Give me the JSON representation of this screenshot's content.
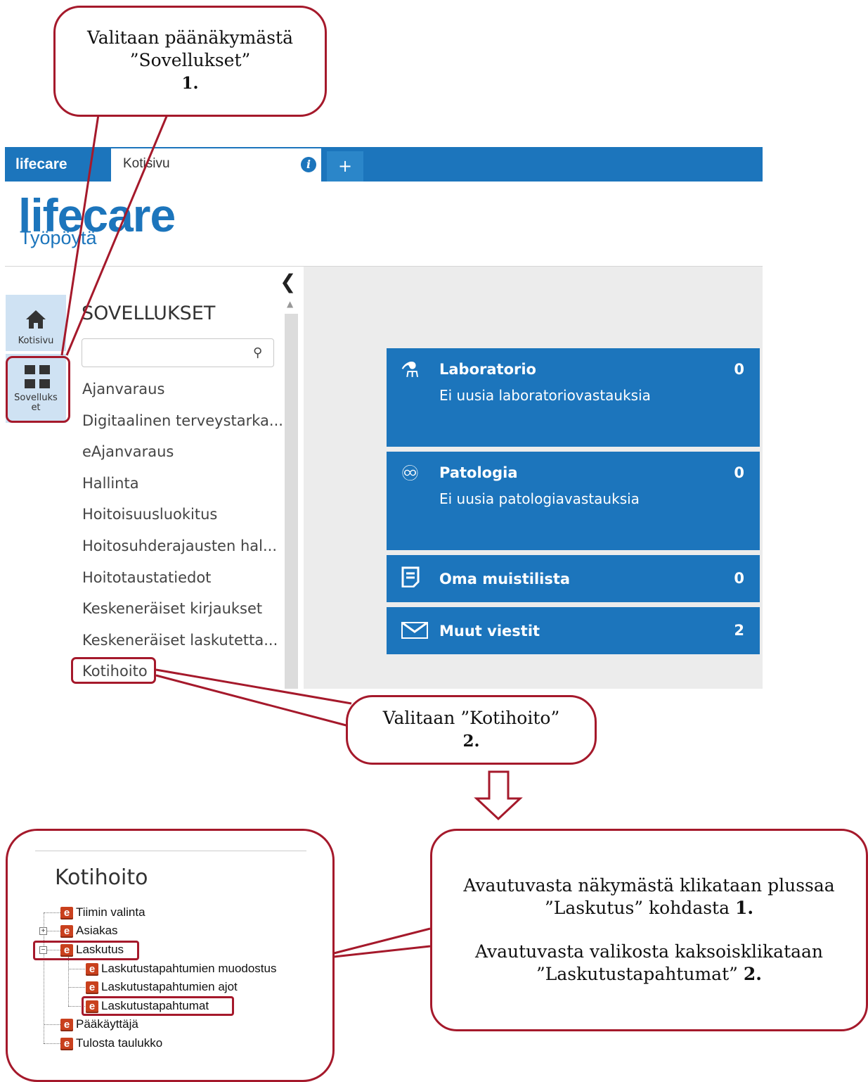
{
  "callouts": {
    "top": {
      "line1": "Valitaan päänäkymästä",
      "line2": "”Sovellukset”",
      "num": "1."
    },
    "middle": {
      "line1": "Valitaan ”Kotihoito”",
      "num": "2."
    },
    "right": {
      "p1_line1": "Avautuvasta näkymästä klikataan plussaa",
      "p1_line2": "”Laskutus” kohdasta",
      "p1_num": "1.",
      "p2_line1": "Avautuvasta valikosta kaksoisklikataan",
      "p2_line2": "”Laskutustapahtumat”",
      "p2_num": "2."
    }
  },
  "topbar": {
    "brand": "lifecare",
    "home_tab": "Kotisivu",
    "plus": "+",
    "info": "i"
  },
  "header": {
    "logo": "lifecare",
    "subtitle": "Työpöytä"
  },
  "rail": {
    "home_label": "Kotisivu",
    "apps_label_1": "Sovelluks",
    "apps_label_2": "et"
  },
  "apps": {
    "title": "SOVELLUKSET",
    "search_value": "",
    "items": [
      "Ajanvaraus",
      "Digitaalinen terveystarka...",
      "eAjanvaraus",
      "Hallinta",
      "Hoitoisuusluokitus",
      "Hoitosuhderajausten hal...",
      "Hoitotaustatiedot",
      "Keskeneräiset kirjaukset",
      "Keskeneräiset laskutetta...",
      "Kotihoito"
    ]
  },
  "tiles": [
    {
      "title": "Laboratorio",
      "subtitle": "Ei uusia laboratoriovastauksia",
      "count": "0",
      "icon": "flask-icon"
    },
    {
      "title": "Patologia",
      "subtitle": "Ei uusia patologiavastauksia",
      "count": "0",
      "icon": "microscope-icon"
    },
    {
      "title": "Oma muistilista",
      "count": "0",
      "icon": "note-icon"
    },
    {
      "title": "Muut viestit",
      "count": "2",
      "icon": "envelope-icon"
    }
  ],
  "tree": {
    "title": "Kotihoito",
    "items": {
      "tiimin": "Tiimin valinta",
      "asiakas": "Asiakas",
      "laskutus": "Laskutus",
      "muodostus": "Laskutustapahtumien muodostus",
      "ajot": "Laskutustapahtumien ajot",
      "tapahtumat": "Laskutustapahtumat",
      "paakayttaja": "Pääkäyttäjä",
      "tulosta": "Tulosta taulukko"
    },
    "icon_letter": "e",
    "expand_plus": "+",
    "expand_minus": "−"
  },
  "colors": {
    "brand_blue": "#1c75bc",
    "callout_red": "#a5192b",
    "rail_blue": "#cfe2f3"
  }
}
